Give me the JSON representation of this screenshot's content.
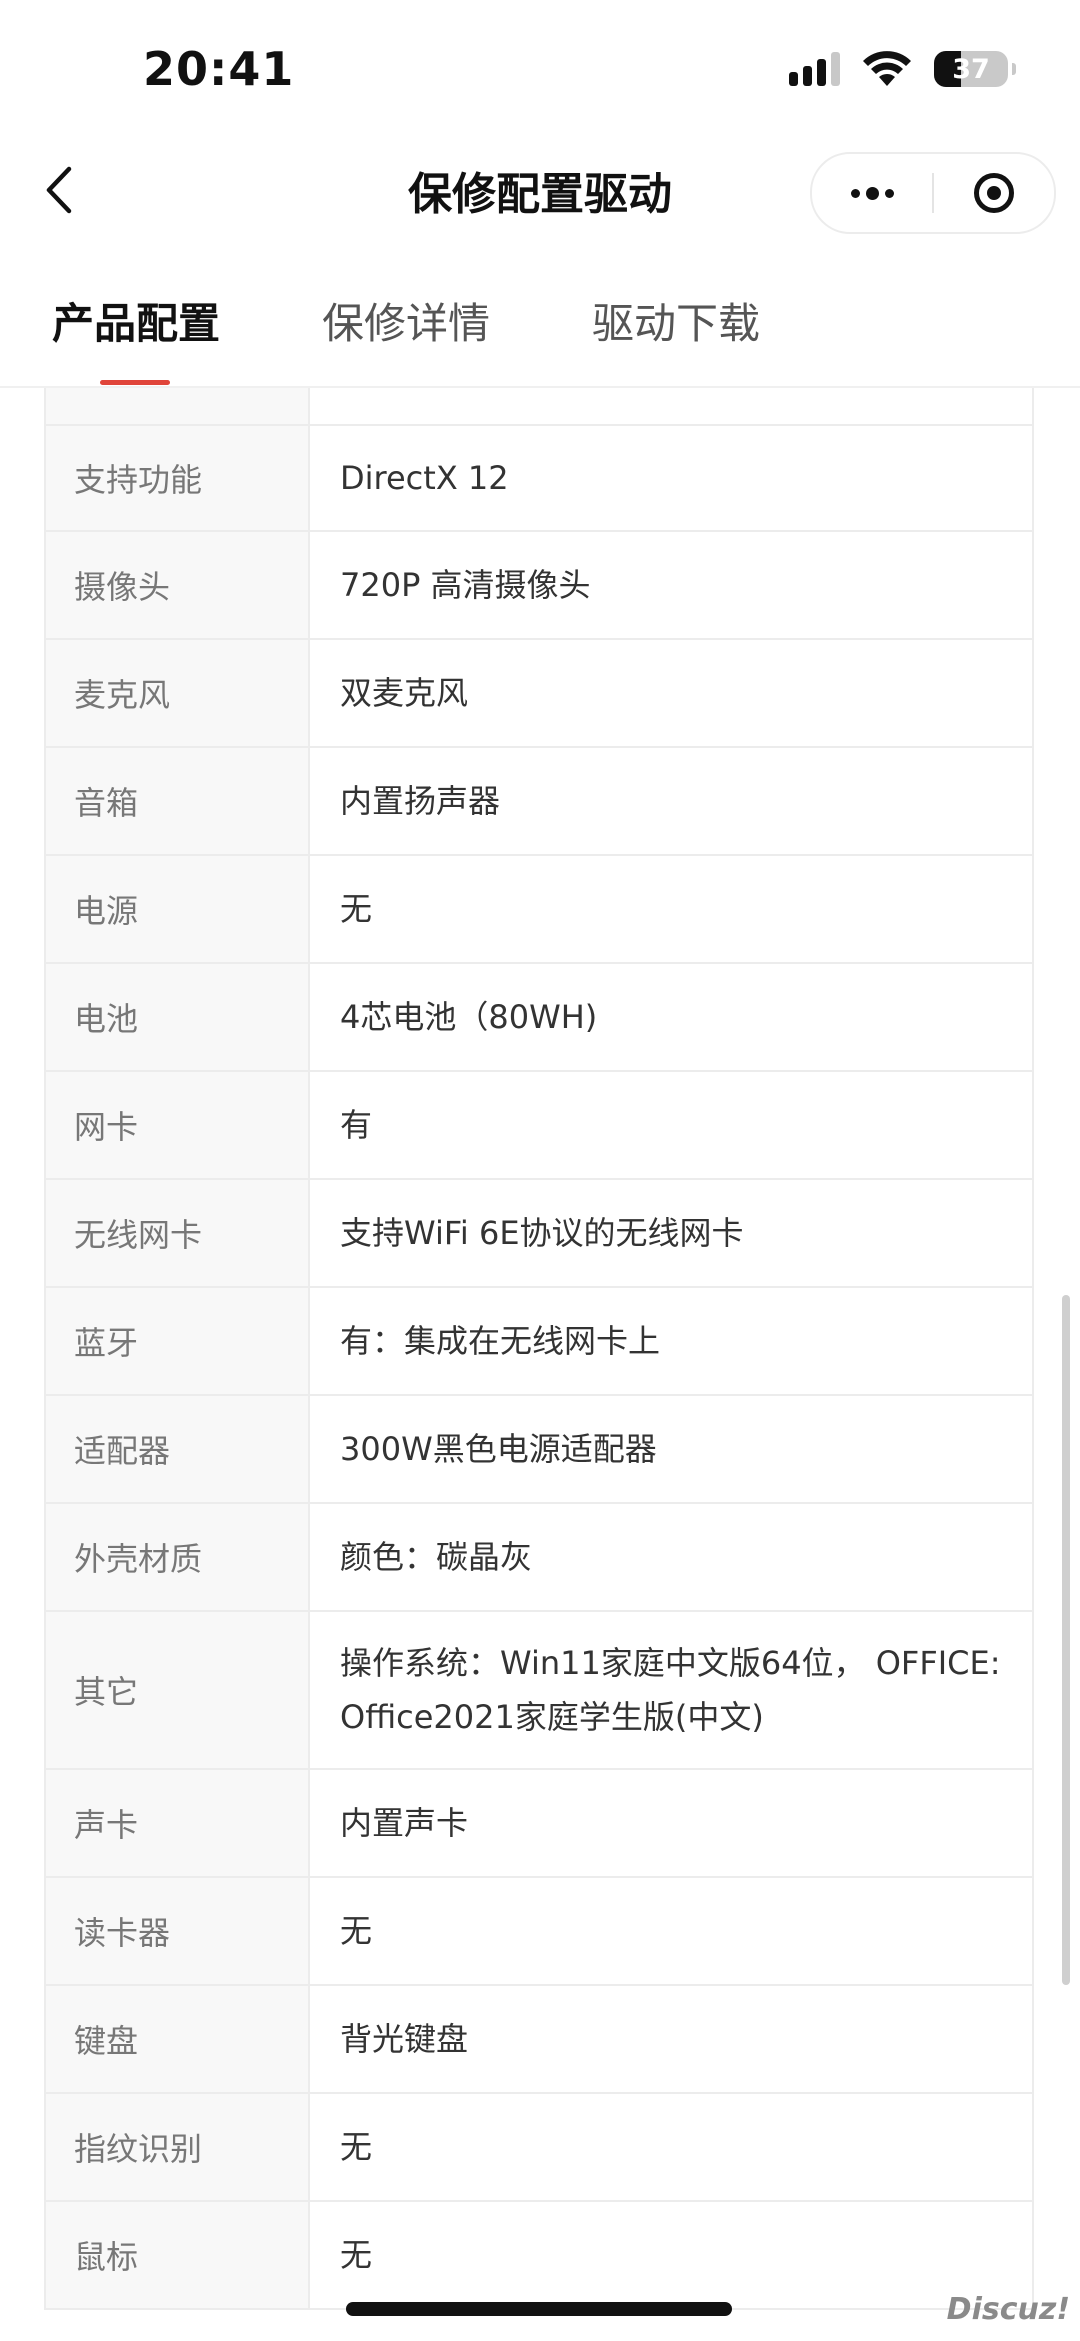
{
  "status_bar": {
    "time": "20:41",
    "battery_level": "37",
    "battery_fraction": 0.37,
    "signal_bars": 4,
    "signal_active": 3
  },
  "nav": {
    "title": "保修配置驱动"
  },
  "tabs": [
    {
      "label": "产品配置",
      "active": true
    },
    {
      "label": "保修详情",
      "active": false
    },
    {
      "label": "驱动下载",
      "active": false
    }
  ],
  "spec_rows": [
    {
      "label": "支持功能",
      "value": "DirectX 12"
    },
    {
      "label": "摄像头",
      "value": "720P 高清摄像头"
    },
    {
      "label": "麦克风",
      "value": "双麦克风"
    },
    {
      "label": "音箱",
      "value": "内置扬声器"
    },
    {
      "label": "电源",
      "value": "无"
    },
    {
      "label": "电池",
      "value": "4芯电池（80WH)"
    },
    {
      "label": "网卡",
      "value": "有"
    },
    {
      "label": "无线网卡",
      "value": "支持WiFi 6E协议的无线网卡"
    },
    {
      "label": "蓝牙",
      "value": "有：集成在无线网卡上"
    },
    {
      "label": "适配器",
      "value": "300W黑色电源适配器"
    },
    {
      "label": "外壳材质",
      "value": "颜色：碳晶灰"
    },
    {
      "label": "其它",
      "value": "操作系统：Win11家庭中文版64位， OFFICE: Office2021家庭学生版(中文)"
    },
    {
      "label": "声卡",
      "value": "内置声卡"
    },
    {
      "label": "读卡器",
      "value": "无"
    },
    {
      "label": "键盘",
      "value": "背光键盘"
    },
    {
      "label": "指纹识别",
      "value": "无"
    },
    {
      "label": "鼠标",
      "value": "无"
    }
  ],
  "watermark": "Discuz!",
  "colors": {
    "accent": "#e0453a",
    "label_bg": "#f8f8f8",
    "border": "#ececec"
  }
}
